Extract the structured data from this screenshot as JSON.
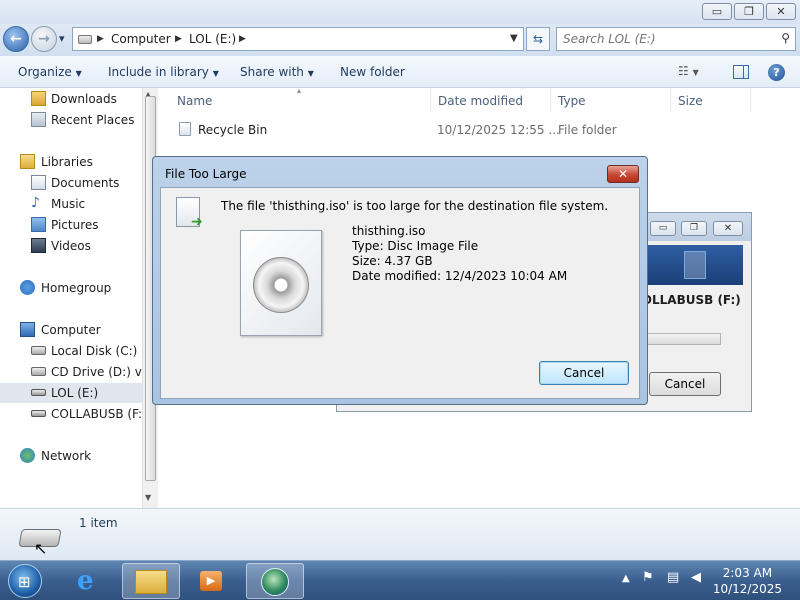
{
  "window": {
    "minimize_glyph": "▭",
    "maximize_glyph": "❐",
    "close_glyph": "✕"
  },
  "nav": {
    "back_glyph": "←",
    "forward_glyph": "→",
    "recent_glyph": "▾",
    "breadcrumb": [
      "Computer",
      "LOL (E:)"
    ],
    "search_placeholder": "Search LOL (E:)"
  },
  "toolbar": {
    "organize": "Organize",
    "include_in_library": "Include in library",
    "share_with": "Share with",
    "new_folder": "New folder"
  },
  "sidebar": {
    "items": [
      {
        "label": "Downloads",
        "icon": "downloads-folder-icon"
      },
      {
        "label": "Recent Places",
        "icon": "recent-places-icon"
      },
      {
        "label": "Libraries",
        "icon": "libraries-icon"
      },
      {
        "label": "Documents",
        "icon": "documents-icon"
      },
      {
        "label": "Music",
        "icon": "music-icon"
      },
      {
        "label": "Pictures",
        "icon": "pictures-icon"
      },
      {
        "label": "Videos",
        "icon": "videos-icon"
      },
      {
        "label": "Homegroup",
        "icon": "homegroup-icon"
      },
      {
        "label": "Computer",
        "icon": "computer-icon"
      },
      {
        "label": "Local Disk (C:)",
        "icon": "hard-drive-icon"
      },
      {
        "label": "CD Drive (D:) virt",
        "icon": "cd-drive-icon"
      },
      {
        "label": "LOL (E:)",
        "icon": "usb-drive-icon"
      },
      {
        "label": "COLLABUSB (F:)",
        "icon": "usb-drive-icon"
      },
      {
        "label": "Network",
        "icon": "network-icon"
      }
    ]
  },
  "columns": {
    "name": "Name",
    "date_modified": "Date modified",
    "type": "Type",
    "size": "Size"
  },
  "files": [
    {
      "name": "Recycle Bin",
      "date": "10/12/2025 12:55 ...",
      "type": "File folder",
      "size": ""
    }
  ],
  "status": {
    "item_count": "1 item"
  },
  "bg_dialog": {
    "drive_label": "COLLABUSB (F:)",
    "cancel": "Cancel"
  },
  "dialog": {
    "title": "File Too Large",
    "message": "The file 'thisthing.iso' is too large for the destination file system.",
    "file_name": "thisthing.iso",
    "file_type": "Type: Disc Image File",
    "file_size": "Size: 4.37 GB",
    "file_date": "Date modified: 12/4/2023 10:04 AM",
    "cancel": "Cancel"
  },
  "taskbar": {
    "time": "2:03 AM",
    "date": "10/12/2025"
  }
}
